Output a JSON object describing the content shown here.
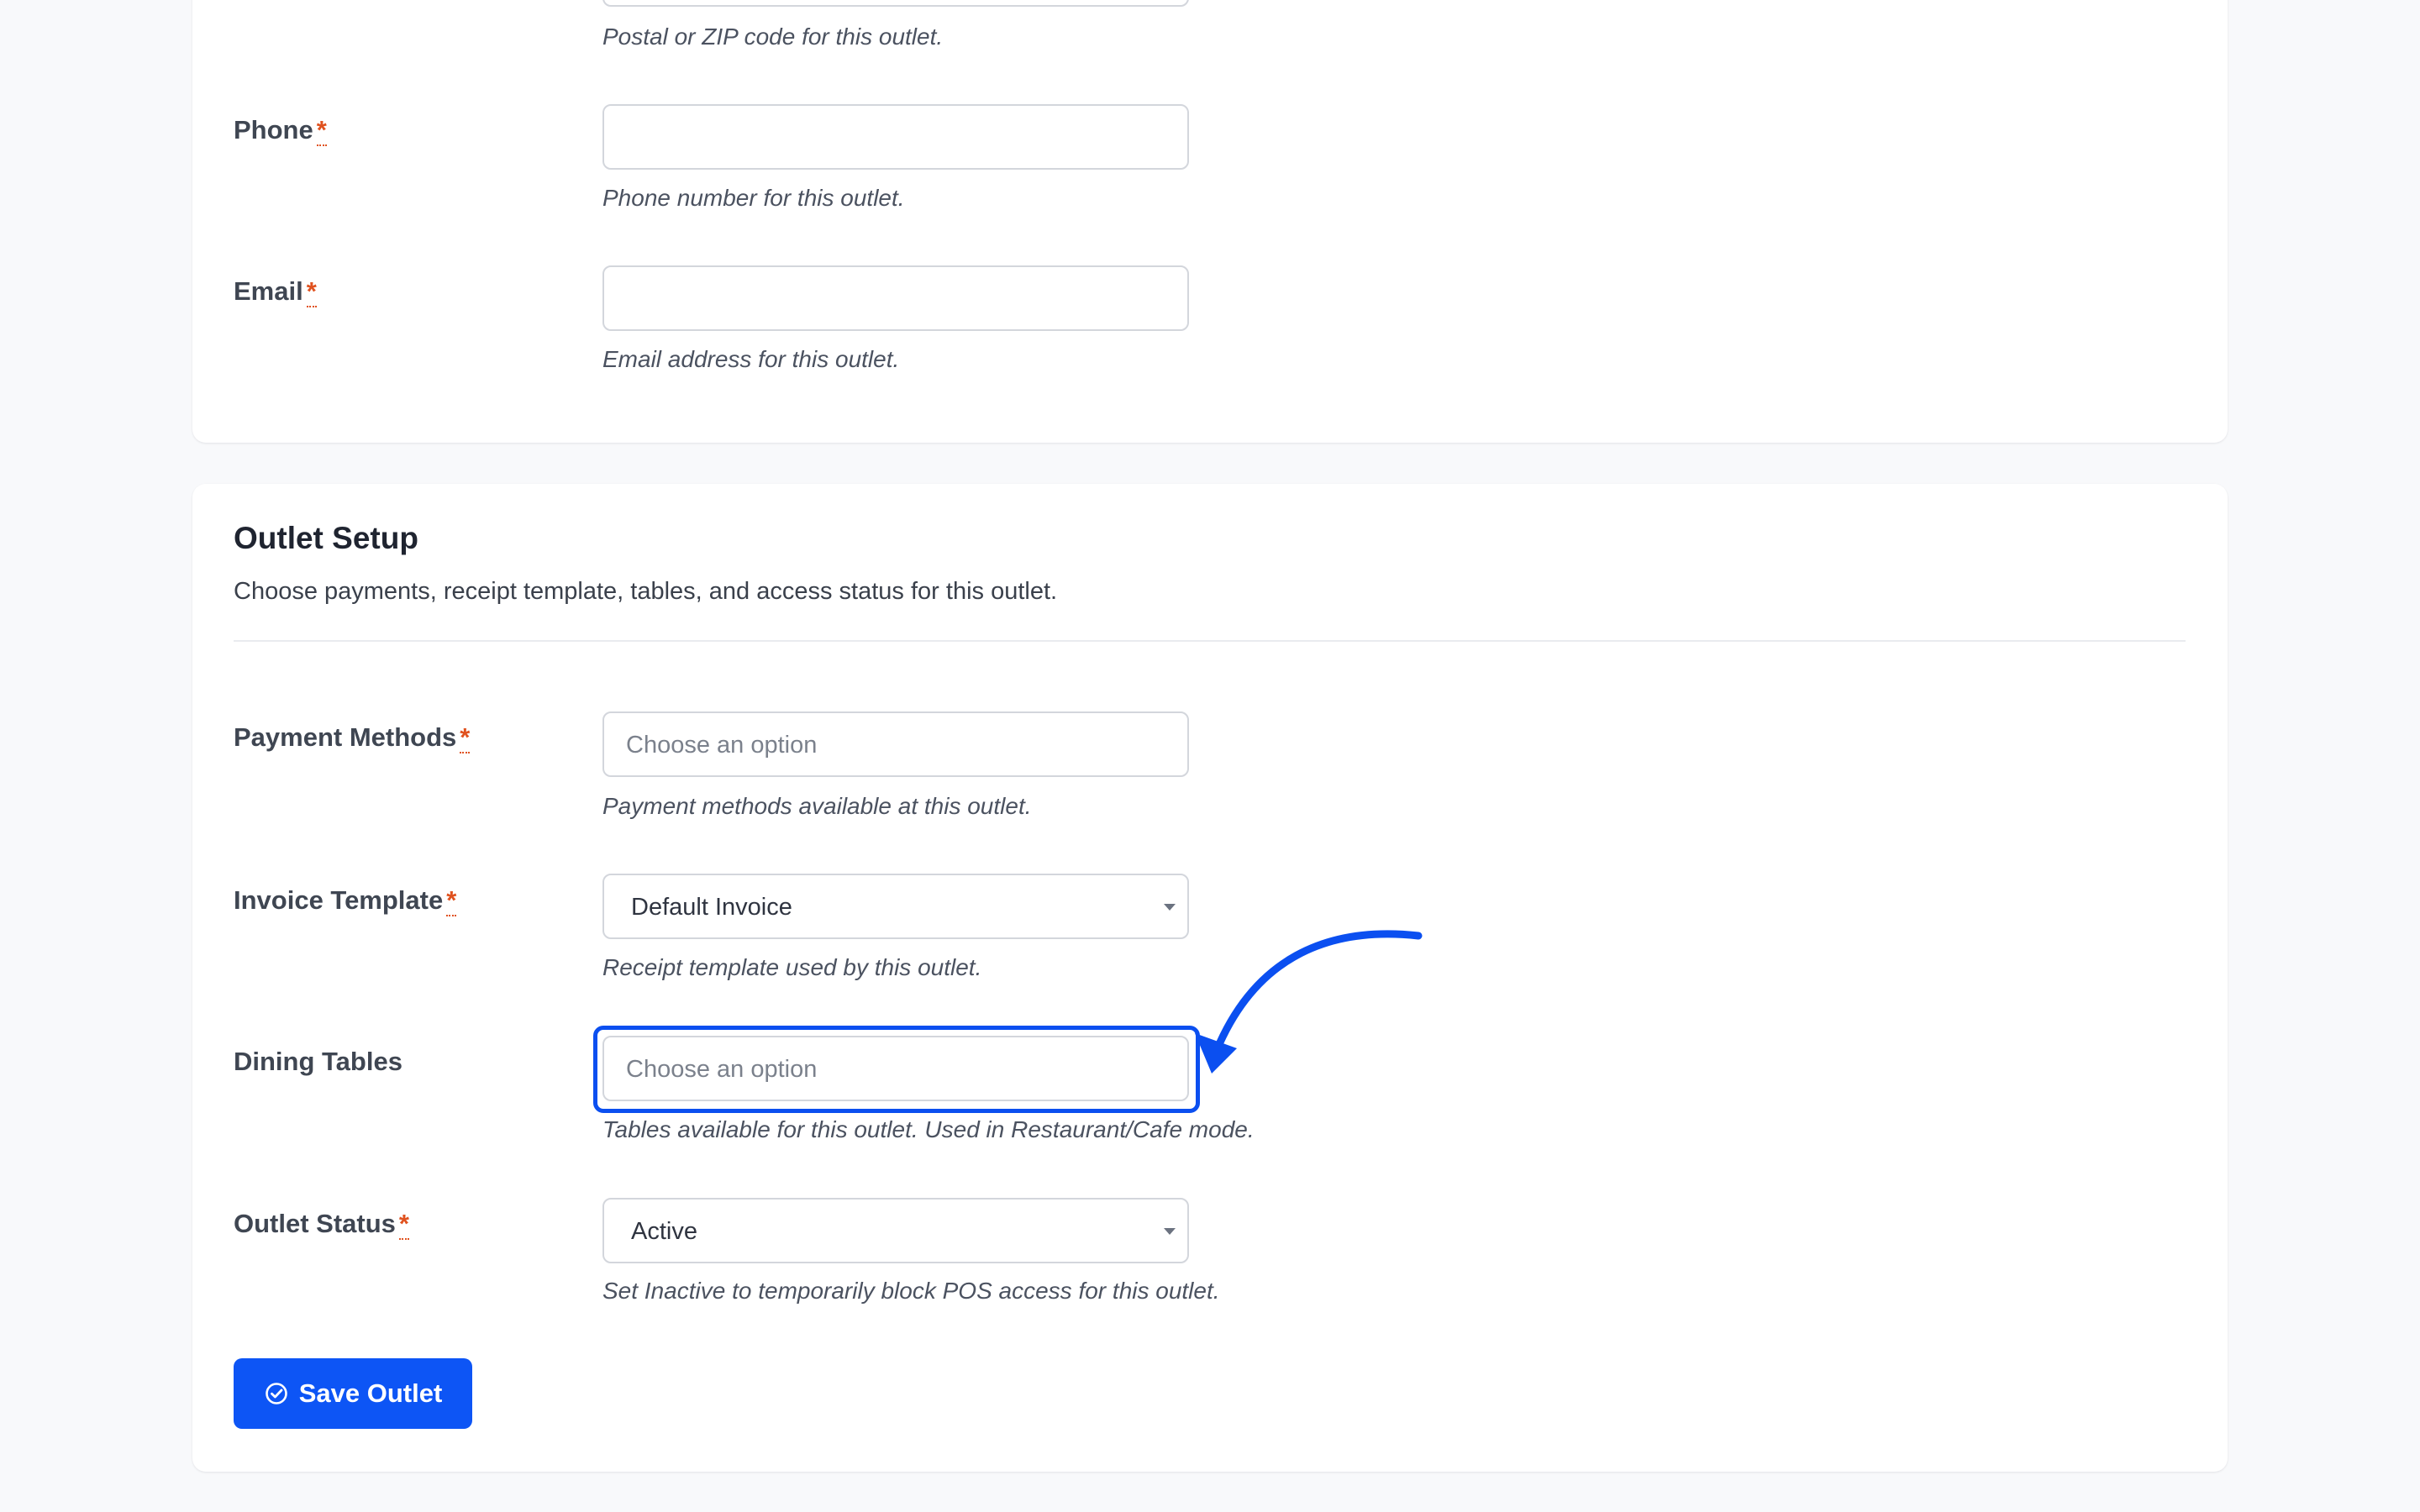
{
  "contact": {
    "postal_help": "Postal or ZIP code for this outlet.",
    "phone": {
      "label": "Phone",
      "required": "*",
      "value": "",
      "help": "Phone number for this outlet."
    },
    "email": {
      "label": "Email",
      "required": "*",
      "value": "",
      "help": "Email address for this outlet."
    }
  },
  "outlet_setup": {
    "title": "Outlet Setup",
    "description": "Choose payments, receipt template, tables, and access status for this outlet.",
    "payment_methods": {
      "label": "Payment Methods",
      "required": "*",
      "placeholder": "Choose an option",
      "help": "Payment methods available at this outlet."
    },
    "invoice_template": {
      "label": "Invoice Template",
      "required": "*",
      "value": "Default Invoice",
      "help": "Receipt template used by this outlet."
    },
    "dining_tables": {
      "label": "Dining Tables",
      "placeholder": "Choose an option",
      "help": "Tables available for this outlet. Used in Restaurant/Cafe mode."
    },
    "outlet_status": {
      "label": "Outlet Status",
      "required": "*",
      "value": "Active",
      "help": "Set Inactive to temporarily block POS access for this outlet."
    }
  },
  "actions": {
    "save_label": "Save Outlet"
  },
  "colors": {
    "primary": "#0d55f5",
    "required": "#e0521f",
    "highlight": "#0b4ff0",
    "background": "#f8f9fb"
  },
  "icons": {
    "save": "check-circle-icon",
    "annotation": "curved-arrow-icon"
  }
}
